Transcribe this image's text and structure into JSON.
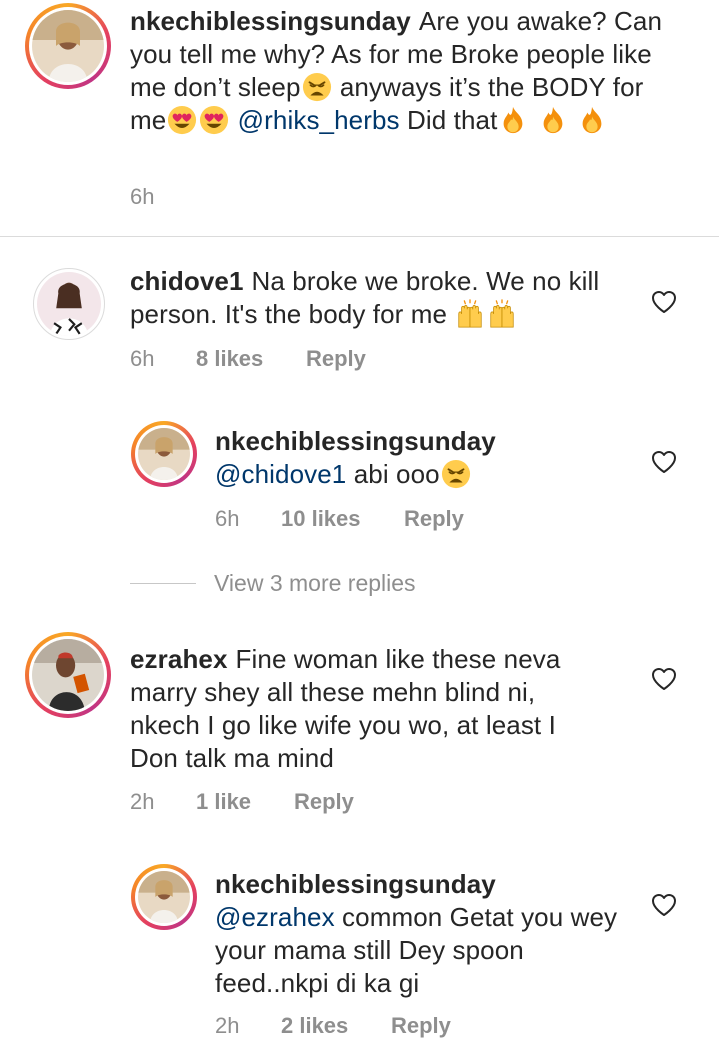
{
  "colors": {
    "text": "#262626",
    "secondary": "#8e8e8e",
    "mention": "#00376b",
    "divider": "#dbdbdb"
  },
  "caption": {
    "username": "nkechiblessingsunday",
    "text_1": "Are you awake? Can you tell me why? As for me Broke people like me don’t sleep",
    "text_2": "anyways it’s the BODY for me",
    "mention": "@rhiks_herbs",
    "text_3": "Did that",
    "emojis": [
      "weary-face-emoji",
      "heart-eyes-emoji",
      "heart-eyes-emoji",
      "fire-emoji",
      "fire-emoji",
      "fire-emoji"
    ],
    "time": "6h"
  },
  "comments": [
    {
      "username": "chidove1",
      "text": "Na broke we broke. We no kill person. It's the body for me",
      "emojis": [
        "raising-hands-emoji",
        "raising-hands-emoji"
      ],
      "time": "6h",
      "likes": "8 likes",
      "reply": "Reply",
      "icon": "heart-outline-icon"
    },
    {
      "username": "nkechiblessingsunday",
      "mention": "@chidove1",
      "text": "abi ooo",
      "emojis": [
        "weary-face-emoji"
      ],
      "time": "6h",
      "likes": "10 likes",
      "reply": "Reply",
      "icon": "heart-outline-icon"
    },
    {
      "username": "ezrahex",
      "text": "Fine woman like these neva marry shey all these mehn blind ni, nkech I go like wife you wo, at least I Don talk ma mind",
      "time": "2h",
      "likes": "1 like",
      "reply": "Reply",
      "icon": "heart-outline-icon"
    },
    {
      "username": "nkechiblessingsunday",
      "mention": "@ezrahex",
      "text": "common Getat you wey your mama still Dey spoon feed..nkpi di ka gi",
      "time": "2h",
      "likes": "2 likes",
      "reply": "Reply",
      "icon": "heart-outline-icon"
    }
  ],
  "view_more": "View 3 more replies"
}
